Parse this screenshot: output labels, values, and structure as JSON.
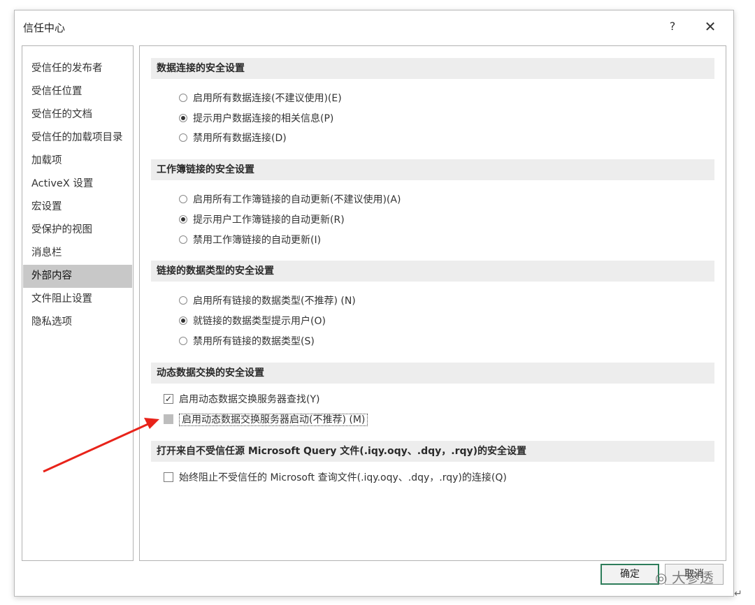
{
  "window": {
    "title": "信任中心",
    "help": "?",
    "close": "✕"
  },
  "sidebar": {
    "items": [
      {
        "label": "受信任的发布者"
      },
      {
        "label": "受信任位置"
      },
      {
        "label": "受信任的文档"
      },
      {
        "label": "受信任的加载项目录"
      },
      {
        "label": "加载项"
      },
      {
        "label": "ActiveX 设置"
      },
      {
        "label": "宏设置"
      },
      {
        "label": "受保护的视图"
      },
      {
        "label": "消息栏"
      },
      {
        "label": "外部内容"
      },
      {
        "label": "文件阻止设置"
      },
      {
        "label": "隐私选项"
      }
    ],
    "selected": "外部内容"
  },
  "sections": {
    "data_conn": {
      "title": "数据连接的安全设置",
      "options": [
        {
          "label": "启用所有数据连接(不建议使用)(E)",
          "selected": false
        },
        {
          "label": "提示用户数据连接的相关信息(P)",
          "selected": true
        },
        {
          "label": "禁用所有数据连接(D)",
          "selected": false
        }
      ]
    },
    "workbook_links": {
      "title": "工作簿链接的安全设置",
      "options": [
        {
          "label": "启用所有工作簿链接的自动更新(不建议使用)(A)",
          "selected": false
        },
        {
          "label": "提示用户工作簿链接的自动更新(R)",
          "selected": true
        },
        {
          "label": "禁用工作簿链接的自动更新(I)",
          "selected": false
        }
      ]
    },
    "linked_types": {
      "title": "链接的数据类型的安全设置",
      "options": [
        {
          "label": "启用所有链接的数据类型(不推荐) (N)",
          "selected": false
        },
        {
          "label": "就链接的数据类型提示用户(O)",
          "selected": true
        },
        {
          "label": "禁用所有链接的数据类型(S)",
          "selected": false
        }
      ]
    },
    "dde": {
      "title": "动态数据交换的安全设置",
      "checks": [
        {
          "label": "启用动态数据交换服务器查找(Y)",
          "checked": true
        },
        {
          "label": "启用动态数据交换服务器启动(不推荐) (M)",
          "checked": false
        }
      ]
    },
    "query": {
      "title": "打开来自不受信任源 Microsoft Query 文件(.iqy.oqy、.dqy，.rqy)的安全设置",
      "checks": [
        {
          "label": "始终阻止不受信任的 Microsoft 查询文件(.iqy.oqy、.dqy，.rqy)的连接(Q)",
          "checked": false
        }
      ]
    }
  },
  "buttons": {
    "ok": "确定",
    "cancel": "取消"
  },
  "watermark": "大参透",
  "return_mark": "↵",
  "annotation": {
    "arrow_color": "#e8231a"
  }
}
